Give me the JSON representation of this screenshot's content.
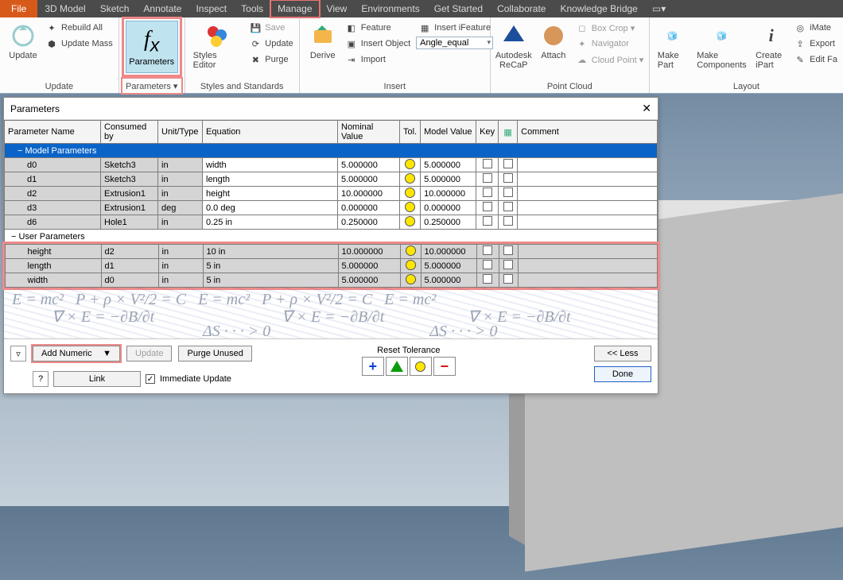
{
  "menubar": {
    "file": "File",
    "items": [
      "3D Model",
      "Sketch",
      "Annotate",
      "Inspect",
      "Tools",
      "Manage",
      "View",
      "Environments",
      "Get Started",
      "Collaborate",
      "Knowledge Bridge"
    ],
    "highlight_index": 5
  },
  "ribbon": {
    "update": {
      "label": "Update",
      "big": "Update",
      "rebuild": "Rebuild All",
      "mass": "Update Mass"
    },
    "parameters": {
      "label": "Parameters ▾",
      "btn": "Parameters"
    },
    "styles": {
      "label": "Styles and Standards",
      "big": "Styles Editor",
      "save": "Save",
      "update": "Update",
      "purge": "Purge"
    },
    "insert": {
      "label": "Insert",
      "big": "Derive",
      "feature": "Feature",
      "obj": "Insert Object",
      "import": "Import",
      "ifeature": "Insert iFeature",
      "combo": "Angle_equal"
    },
    "pointcloud": {
      "label": "Point Cloud",
      "recap": "Autodesk ReCaP",
      "attach": "Attach",
      "box": "Box Crop ▾",
      "nav": "Navigator",
      "cloud": "Cloud Point ▾"
    },
    "layout": {
      "label": "Layout",
      "part": "Make Part",
      "comp": "Make Components",
      "ipart": "Create iPart",
      "imate": "iMate",
      "export": "Export",
      "editfa": "Edit Fa"
    }
  },
  "pwin": {
    "title": "Parameters",
    "headers": [
      "Parameter Name",
      "Consumed by",
      "Unit/Type",
      "Equation",
      "Nominal Value",
      "Tol.",
      "Model Value",
      "Key",
      "",
      "Comment"
    ],
    "section1": "Model Parameters",
    "rows1": [
      {
        "n": "d0",
        "c": "Sketch3",
        "u": "in",
        "e": "width",
        "nv": "5.000000",
        "mv": "5.000000"
      },
      {
        "n": "d1",
        "c": "Sketch3",
        "u": "in",
        "e": "length",
        "nv": "5.000000",
        "mv": "5.000000"
      },
      {
        "n": "d2",
        "c": "Extrusion1",
        "u": "in",
        "e": "height",
        "nv": "10.000000",
        "mv": "10.000000"
      },
      {
        "n": "d3",
        "c": "Extrusion1",
        "u": "deg",
        "e": "0.0 deg",
        "nv": "0.000000",
        "mv": "0.000000"
      },
      {
        "n": "d6",
        "c": "Hole1",
        "u": "in",
        "e": "0.25 in",
        "nv": "0.250000",
        "mv": "0.250000"
      }
    ],
    "section2": "User Parameters",
    "rows2": [
      {
        "n": "height",
        "c": "d2",
        "u": "in",
        "e": "10 in",
        "nv": "10.000000",
        "mv": "10.000000"
      },
      {
        "n": "length",
        "c": "d1",
        "u": "in",
        "e": "5 in",
        "nv": "5.000000",
        "mv": "5.000000"
      },
      {
        "n": "width",
        "c": "d0",
        "u": "in",
        "e": "5 in",
        "nv": "5.000000",
        "mv": "5.000000"
      }
    ],
    "addnum": "Add Numeric",
    "updatebtn": "Update",
    "purge": "Purge Unused",
    "reset": "Reset Tolerance",
    "less": "<< Less",
    "done": "Done",
    "link": "Link",
    "imm": "Immediate Update"
  }
}
